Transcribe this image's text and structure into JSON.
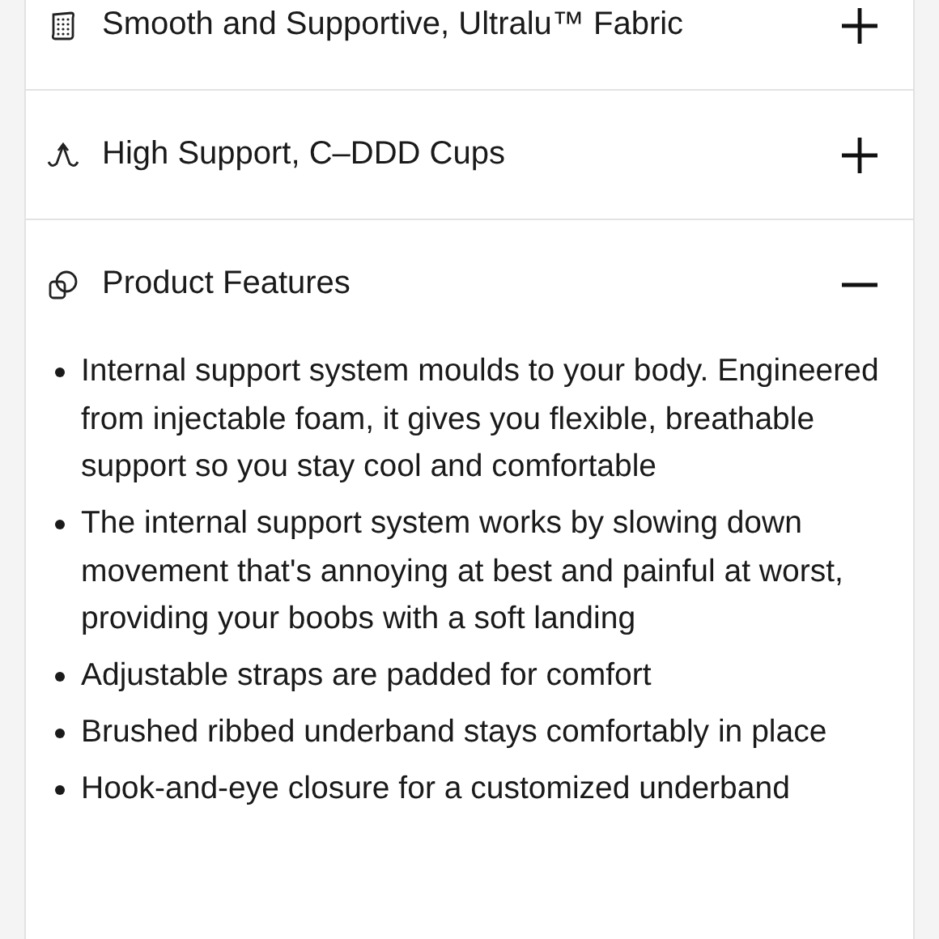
{
  "sections": [
    {
      "title": "Smooth and Supportive, Ultralu™ Fabric",
      "expanded": false
    },
    {
      "title": "High Support, C–DDD Cups",
      "expanded": false
    },
    {
      "title": "Product Features",
      "expanded": true,
      "bullets": [
        "Internal support system moulds to your body. Engineered from injectable foam, it gives you flexible, breathable support so you stay cool and comfortable",
        "The internal support system works by slowing down movement that's annoying at best and painful at worst, providing your boobs with a soft landing",
        "Adjustable straps are padded for comfort",
        "Brushed ribbed underband stays comfortably in place",
        "Hook-and-eye closure for a customized underband"
      ]
    }
  ]
}
